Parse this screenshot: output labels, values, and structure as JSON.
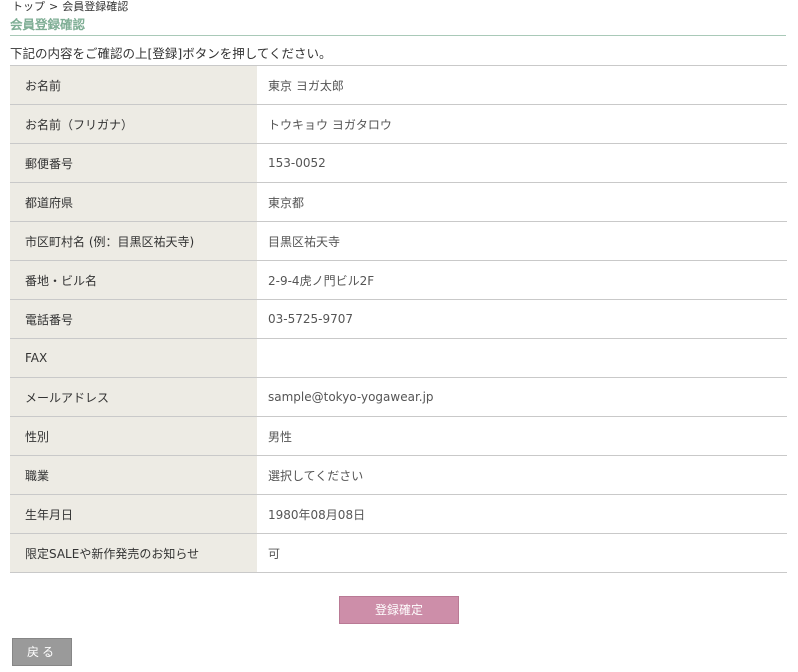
{
  "breadcrumb": {
    "home_label": "トップ",
    "separator": ">",
    "current_label": "会員登録確認"
  },
  "page": {
    "title": "会員登録確認",
    "instruction": "下記の内容をご確認の上[登録]ボタンを押してください。"
  },
  "form_rows": [
    {
      "label": "お名前",
      "value": "東京 ヨガ太郎"
    },
    {
      "label": "お名前（フリガナ）",
      "value": "トウキョウ ヨガタロウ"
    },
    {
      "label": "郵便番号",
      "value": "153-0052"
    },
    {
      "label": "都道府県",
      "value": "東京都"
    },
    {
      "label": "市区町村名 (例：目黒区祐天寺)",
      "value": "目黒区祐天寺"
    },
    {
      "label": "番地・ビル名",
      "value": "2-9-4虎ノ門ビル2F"
    },
    {
      "label": "電話番号",
      "value": "03-5725-9707"
    },
    {
      "label": "FAX",
      "value": ""
    },
    {
      "label": "メールアドレス",
      "value": "sample@tokyo-yogawear.jp"
    },
    {
      "label": "性別",
      "value": "男性"
    },
    {
      "label": "職業",
      "value": "選択してください"
    },
    {
      "label": "生年月日",
      "value": "1980年08月08日"
    },
    {
      "label": "限定SALEや新作発売のお知らせ",
      "value": "可"
    }
  ],
  "buttons": {
    "submit_label": "登録確定",
    "back_label": "戻る"
  },
  "colors": {
    "title_green": "#7fae95",
    "label_bg": "#edebe4",
    "submit_pink": "#cd8ea9",
    "back_gray": "#9a9a9a"
  }
}
